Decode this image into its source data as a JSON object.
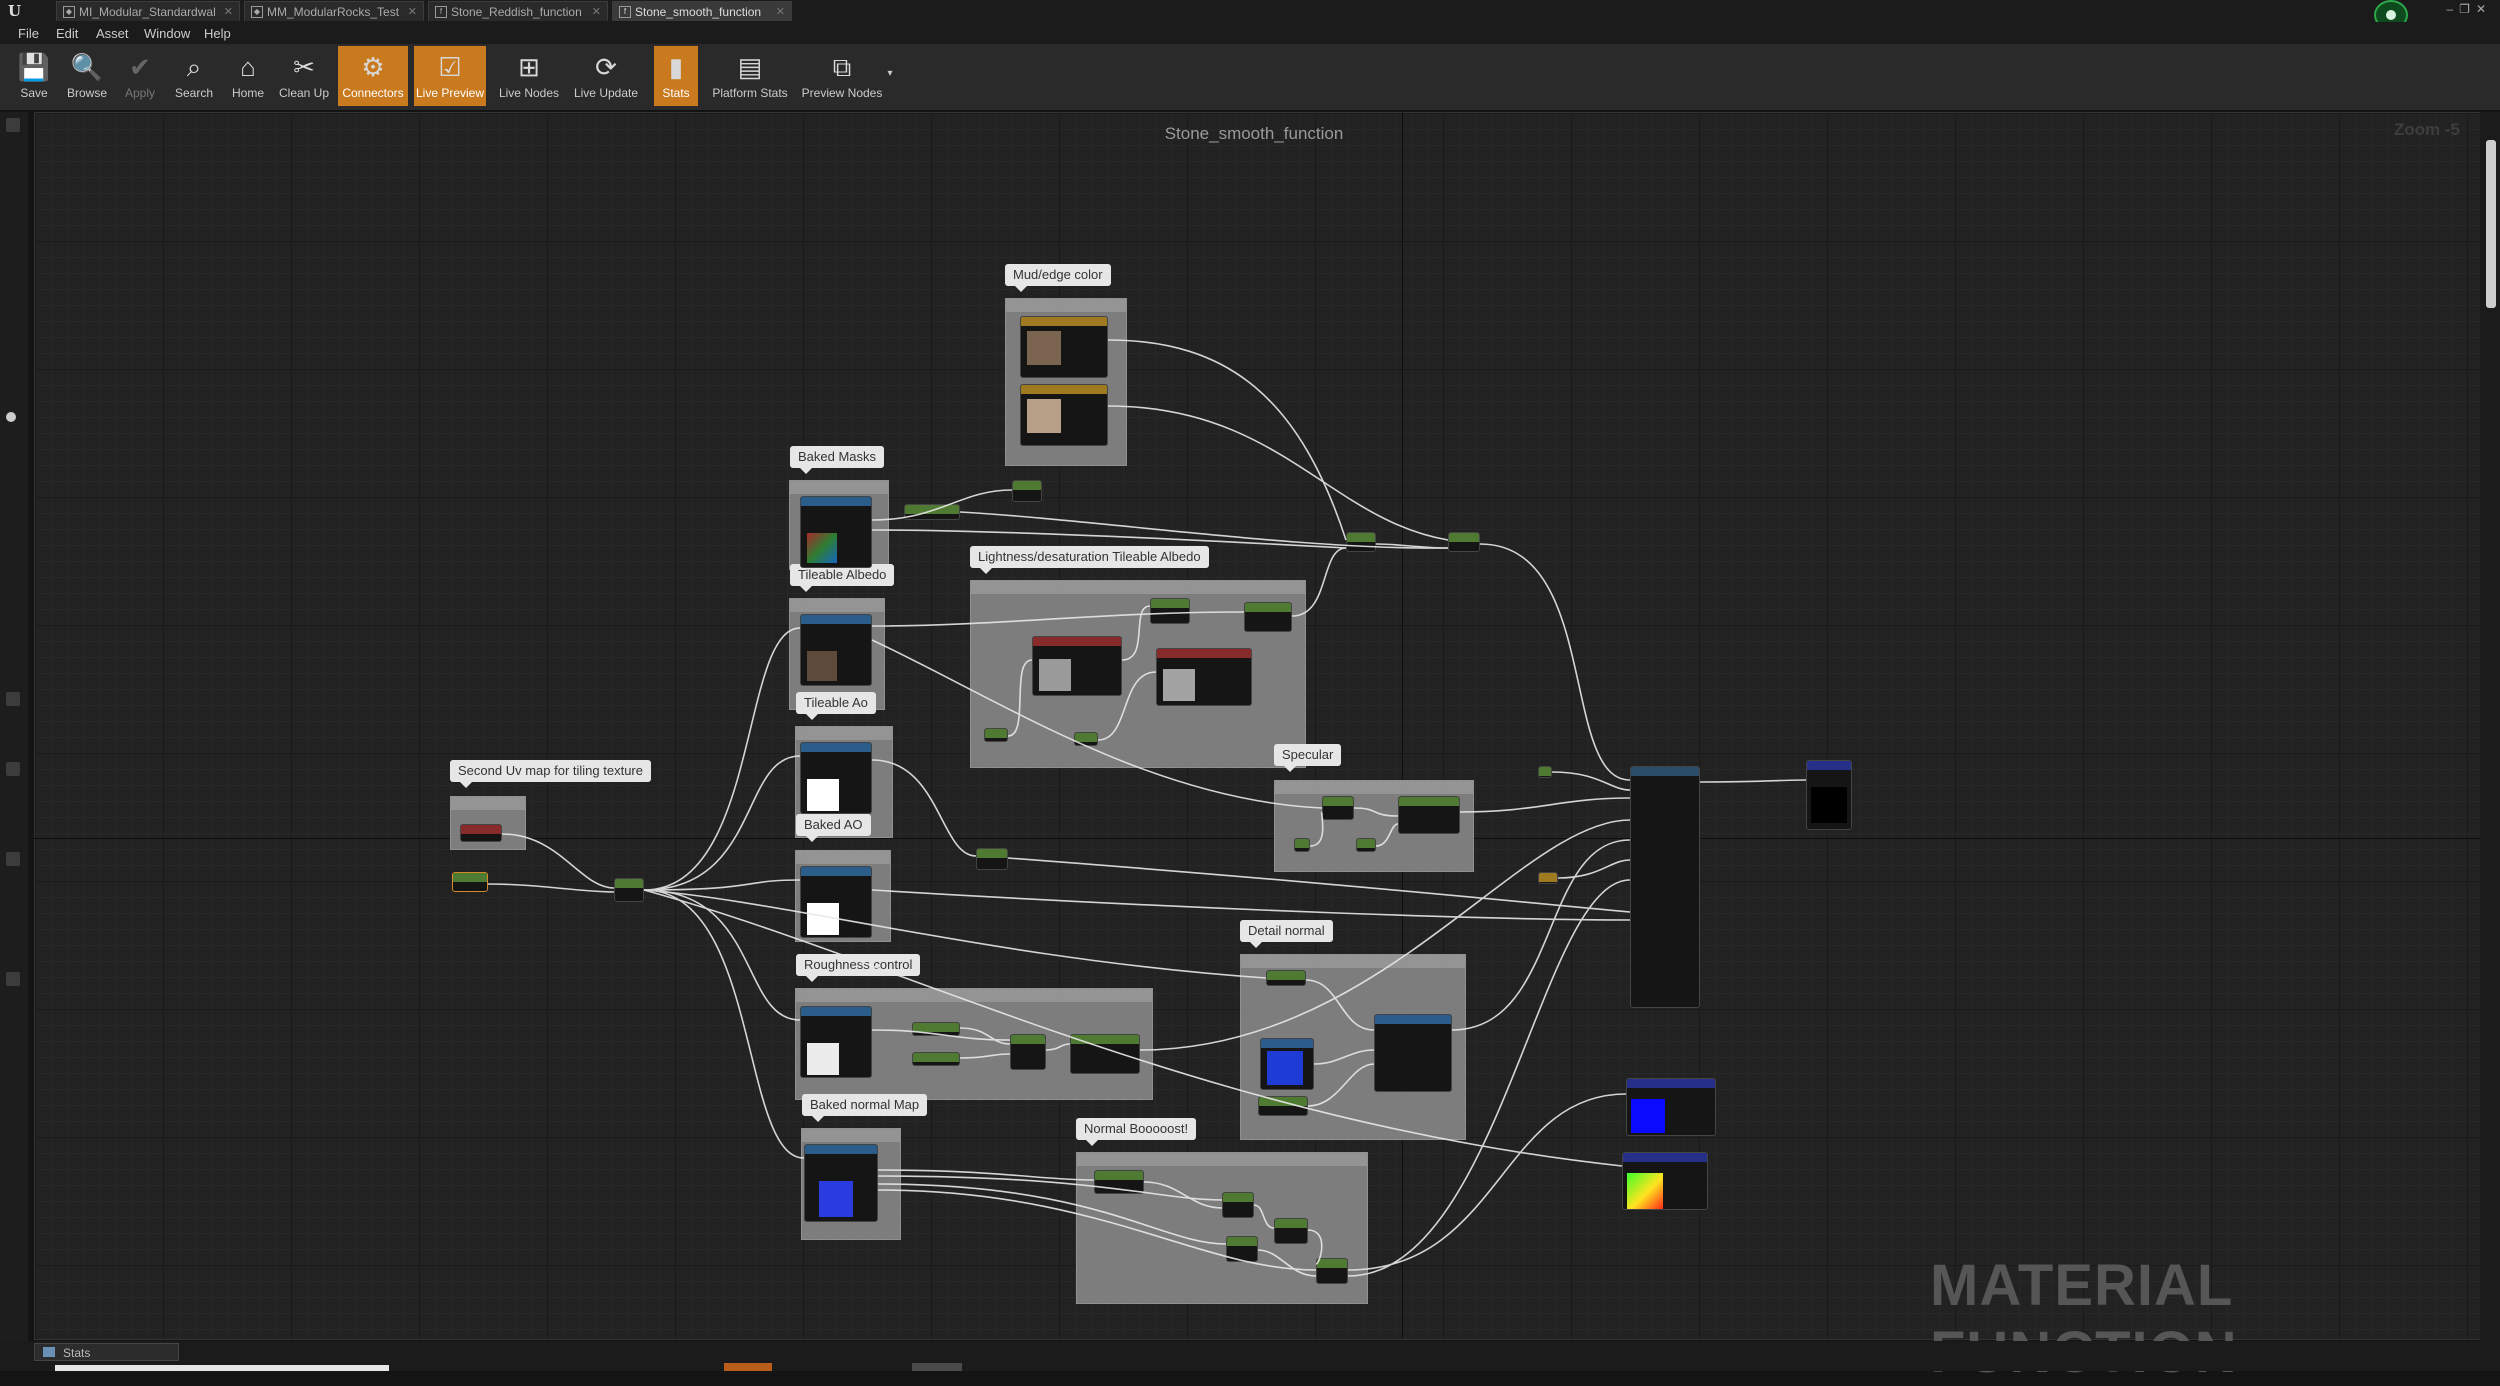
{
  "tabs": [
    {
      "label": "MI_Modular_Standardwal",
      "active": false
    },
    {
      "label": "MM_ModularRocks_Test",
      "active": false
    },
    {
      "label": "Stone_Reddish_function",
      "active": false
    },
    {
      "label": "Stone_smooth_function",
      "active": true
    }
  ],
  "menu": [
    "File",
    "Edit",
    "Asset",
    "Window",
    "Help"
  ],
  "toolbar": [
    {
      "label": "Save",
      "icon": "save-icon",
      "state": "normal"
    },
    {
      "label": "Browse",
      "icon": "browse-icon",
      "state": "normal"
    },
    {
      "label": "Apply",
      "icon": "apply-icon",
      "state": "disabled"
    },
    {
      "label": "Search",
      "icon": "search-icon",
      "state": "normal"
    },
    {
      "label": "Home",
      "icon": "home-icon",
      "state": "normal"
    },
    {
      "label": "Clean Up",
      "icon": "clean-up-icon",
      "state": "normal"
    },
    {
      "label": "Connectors",
      "icon": "connectors-icon",
      "state": "active"
    },
    {
      "label": "Live Preview",
      "icon": "live-preview-icon",
      "state": "active"
    },
    {
      "label": "Live Nodes",
      "icon": "live-nodes-icon",
      "state": "normal"
    },
    {
      "label": "Live Update",
      "icon": "live-update-icon",
      "state": "normal"
    },
    {
      "label": "Stats",
      "icon": "stats-icon",
      "state": "active"
    },
    {
      "label": "Platform Stats",
      "icon": "platform-stats-icon",
      "state": "normal"
    },
    {
      "label": "Preview Nodes",
      "icon": "preview-nodes-icon",
      "state": "normal"
    }
  ],
  "graph": {
    "title": "Stone_smooth_function",
    "zoom": "Zoom -5",
    "watermark": "MATERIAL FUNCTION"
  },
  "comments": [
    {
      "title": "Mud/edge color"
    },
    {
      "title": "Baked Masks"
    },
    {
      "title": "Tileable Albedo"
    },
    {
      "title": "Lightness/desaturation Tileable Albedo"
    },
    {
      "title": "Tileable Ao"
    },
    {
      "title": "Specular"
    },
    {
      "title": "Second Uv map for tiling texture"
    },
    {
      "title": "Baked AO"
    },
    {
      "title": "Detail normal"
    },
    {
      "title": "Roughness control"
    },
    {
      "title": "Baked normal Map"
    },
    {
      "title": "Normal Booooost!"
    }
  ],
  "colors": {
    "accent": "#c97a1f",
    "grid": "#222222",
    "comment": "#858585",
    "bubble": "#e6e6e6"
  },
  "statusbar": {
    "stats_tab": "Stats"
  }
}
